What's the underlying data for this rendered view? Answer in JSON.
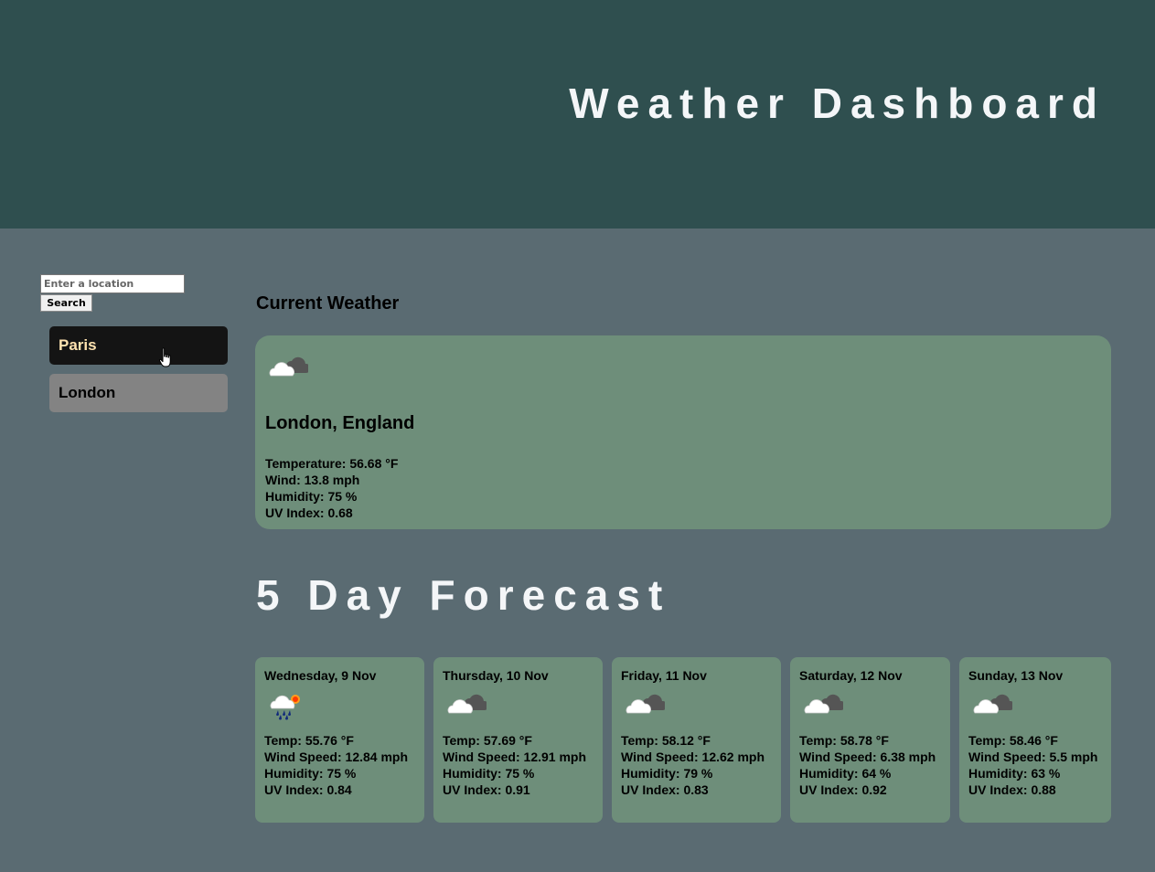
{
  "header": {
    "title": "Weather Dashboard"
  },
  "search": {
    "placeholder": "Enter a location",
    "value": "",
    "button_label": "Search"
  },
  "history": [
    {
      "label": "Paris",
      "active": true
    },
    {
      "label": "London",
      "active": false
    }
  ],
  "current": {
    "heading": "Current Weather",
    "icon": "cloudy-icon",
    "city": "London, England",
    "temperature": "Temperature: 56.68 °F",
    "wind": "Wind: 13.8 mph",
    "humidity": "Humidity: 75 %",
    "uv": "UV Index: 0.68"
  },
  "forecast": {
    "heading": "5 Day Forecast",
    "days": [
      {
        "date": "Wednesday, 9 Nov",
        "icon": "rain-sun-icon",
        "temp": "Temp: 55.76 °F",
        "wind": "Wind Speed: 12.84 mph",
        "humidity": "Humidity: 75 %",
        "uv": "UV Index: 0.84"
      },
      {
        "date": "Thursday, 10 Nov",
        "icon": "cloudy-icon",
        "temp": "Temp: 57.69 °F",
        "wind": "Wind Speed: 12.91 mph",
        "humidity": "Humidity: 75 %",
        "uv": "UV Index: 0.91"
      },
      {
        "date": "Friday, 11 Nov",
        "icon": "cloudy-icon",
        "temp": "Temp: 58.12 °F",
        "wind": "Wind Speed: 12.62 mph",
        "humidity": "Humidity: 79 %",
        "uv": "UV Index: 0.83"
      },
      {
        "date": "Saturday, 12 Nov",
        "icon": "cloudy-icon",
        "temp": "Temp: 58.78 °F",
        "wind": "Wind Speed: 6.38 mph",
        "humidity": "Humidity: 64 %",
        "uv": "UV Index: 0.92"
      },
      {
        "date": "Sunday, 13 Nov",
        "icon": "cloudy-icon",
        "temp": "Temp: 58.46 °F",
        "wind": "Wind Speed: 5.5 mph",
        "humidity": "Humidity: 63 %",
        "uv": "UV Index: 0.88"
      }
    ]
  },
  "colors": {
    "header_bg": "#2f4f4f",
    "page_bg": "#5a6b72",
    "card_bg": "#6e8e7a",
    "active_history_bg": "#141414",
    "active_history_text": "#ffe3b0",
    "inactive_history_bg": "#838383"
  }
}
